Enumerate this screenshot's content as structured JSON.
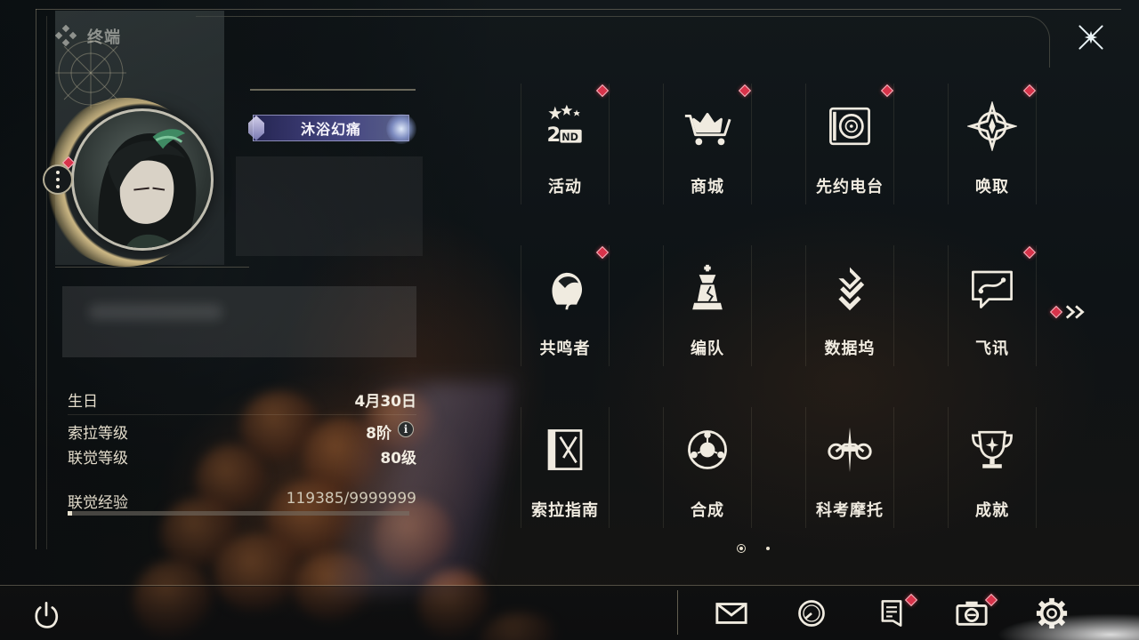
{
  "header": {
    "title": "终端"
  },
  "profile": {
    "title_badge": "沐浴幻痛",
    "stats": {
      "birthday_label": "生日",
      "birthday_value": "4月30日",
      "sola_level_label": "索拉等级",
      "sola_level_value": "8阶",
      "union_level_label": "联觉等级",
      "union_level_value": "80级",
      "exp_label": "联觉经验",
      "exp_value": "119385/9999999",
      "exp_progress": 0.012
    }
  },
  "menu": {
    "rows": [
      [
        {
          "label": "活动",
          "icon": "event-2nd-icon",
          "badge": true
        },
        {
          "label": "商城",
          "icon": "shop-cart-icon",
          "badge": true
        },
        {
          "label": "先约电台",
          "icon": "radio-icon",
          "badge": true
        },
        {
          "label": "唤取",
          "icon": "convene-icon",
          "badge": true
        }
      ],
      [
        {
          "label": "共鸣者",
          "icon": "resonator-icon",
          "badge": true
        },
        {
          "label": "编队",
          "icon": "team-chess-icon",
          "badge": false
        },
        {
          "label": "数据坞",
          "icon": "data-bank-icon",
          "badge": false
        },
        {
          "label": "飞讯",
          "icon": "message-icon",
          "badge": true
        }
      ],
      [
        {
          "label": "索拉指南",
          "icon": "guidebook-icon",
          "badge": false
        },
        {
          "label": "合成",
          "icon": "synthesis-icon",
          "badge": false
        },
        {
          "label": "科考摩托",
          "icon": "motorcycle-icon",
          "badge": false
        },
        {
          "label": "成就",
          "icon": "trophy-icon",
          "badge": false
        }
      ]
    ],
    "page_count": 2,
    "current_page": 1
  },
  "bottom_bar": {
    "icons": [
      "power-icon",
      "mail-icon",
      "clock-icon",
      "notice-icon",
      "camera-icon",
      "settings-gear-icon"
    ]
  },
  "colors": {
    "accent_red": "#d8334a",
    "text_primary": "#f0ebe0",
    "frame_gold": "#c8be a0"
  }
}
